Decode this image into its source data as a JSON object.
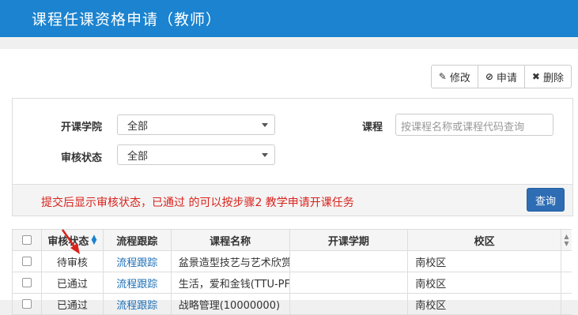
{
  "header": {
    "title": "课程任课资格申请（教师）"
  },
  "toolbar": {
    "edit_label": "修改",
    "apply_label": "申请",
    "delete_label": "删除"
  },
  "filters": {
    "college_label": "开课学院",
    "college_value": "全部",
    "status_label": "审核状态",
    "status_value": "全部",
    "course_label": "课程",
    "course_placeholder": "按课程名称或课程代码查询"
  },
  "note": "提交后显示审核状态，已通过 的可以按步骤2 教学申请开课任务",
  "query_label": "查询",
  "table": {
    "columns": [
      "审核状态",
      "流程跟踪",
      "课程名称",
      "开课学期",
      "校区"
    ],
    "rows": [
      {
        "status": "待审核",
        "track": "流程跟踪",
        "course": "盆景造型技艺与艺术欣赏",
        "term": "",
        "campus": "南校区"
      },
      {
        "status": "已通过",
        "track": "流程跟踪",
        "course": "生活，爱和金钱(TTU-PF",
        "term": "",
        "campus": "南校区"
      },
      {
        "status": "已通过",
        "track": "流程跟踪",
        "course": "战略管理(10000000)",
        "term": "",
        "campus": "南校区"
      }
    ]
  },
  "colors": {
    "header_bg": "#1b83cf",
    "note_text": "#d9231d",
    "query_bg": "#2e6db4",
    "link": "#1e6fb5"
  }
}
